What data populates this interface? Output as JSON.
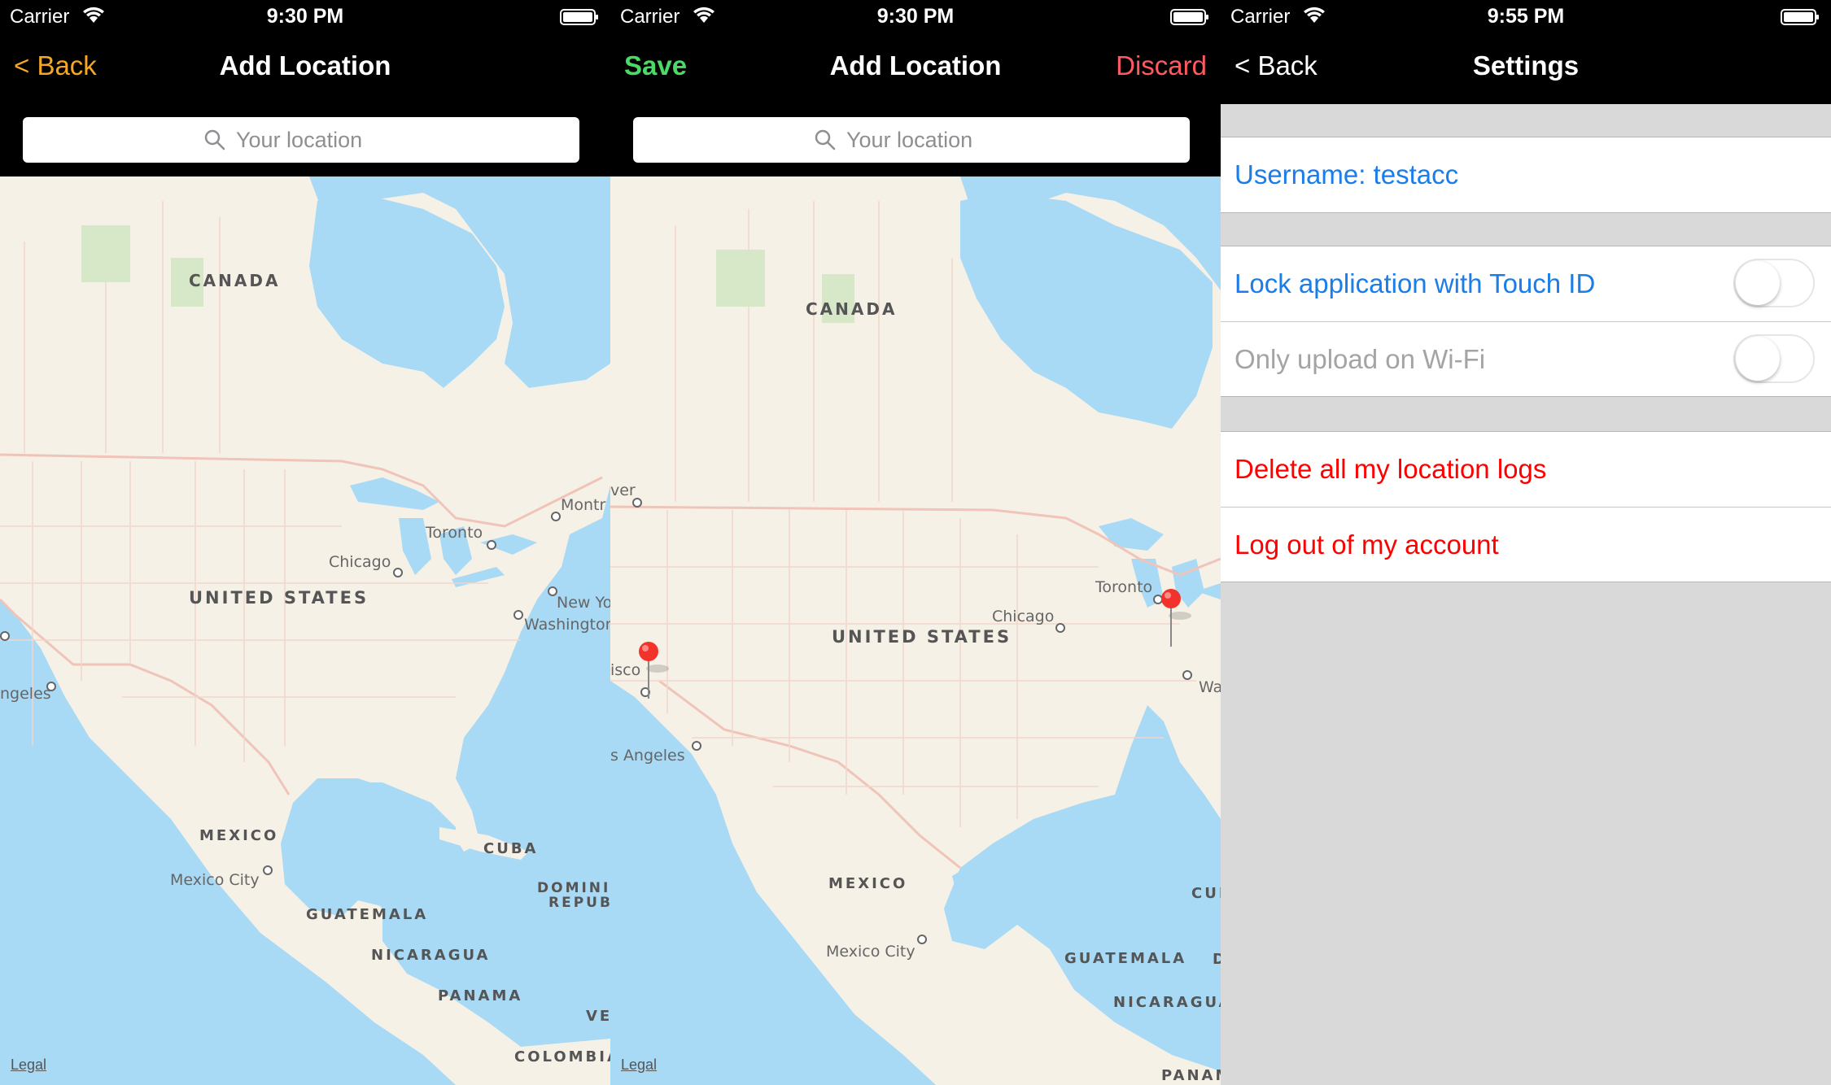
{
  "colors": {
    "accent_orange": "#f5a623",
    "save_green": "#4cd964",
    "discard_red": "#ff5a5f",
    "settings_blue": "#1a7de8",
    "danger_red": "#ff0000",
    "map_water": "#a8d9f5",
    "map_land": "#f6f1e7"
  },
  "screens": [
    {
      "status": {
        "carrier": "Carrier",
        "time": "9:30 PM"
      },
      "nav": {
        "left_label": "< Back",
        "title": "Add Location",
        "right_label": ""
      },
      "search": {
        "placeholder": "Your location"
      },
      "map": {
        "labels": {
          "canada": "CANADA",
          "usa": "UNITED STATES",
          "mexico": "MEXICO",
          "cuba": "CUBA",
          "guatemala": "GUATEMALA",
          "nicaragua": "NICARAGUA",
          "panama": "PANAMA",
          "colombia": "COLOMBIA",
          "dominican1": "DOMINI",
          "dominican2": "REPUB",
          "venezuela": "VE",
          "chicago": "Chicago",
          "toronto": "Toronto",
          "montreal": "Montr",
          "newyork": "New Yo",
          "washington": "Washington",
          "losangeles": "ngeles",
          "mexicocity": "Mexico City"
        },
        "legal": "Legal"
      }
    },
    {
      "status": {
        "carrier": "Carrier",
        "time": "9:30 PM"
      },
      "nav": {
        "left_label": "Save",
        "title": "Add Location",
        "right_label": "Discard"
      },
      "search": {
        "placeholder": "Your location"
      },
      "map": {
        "labels": {
          "canada": "CANADA",
          "usa": "UNITED STATES",
          "mexico": "MEXICO",
          "cuba": "CUBA",
          "guatemala": "GUATEMALA",
          "nicaragua": "NICARAGUA",
          "panama": "PANAMA",
          "chicago": "Chicago",
          "toronto": "Toronto",
          "vancouver": "ver",
          "sanfrancisco": "isco",
          "losangeles": "s Angeles",
          "washington": "Was",
          "mexicocity": "Mexico City",
          "dominican": "D"
        },
        "legal": "Legal",
        "pins": [
          "san-francisco",
          "new-york"
        ]
      }
    },
    {
      "status": {
        "carrier": "Carrier",
        "time": "9:55 PM"
      },
      "nav": {
        "left_label": "< Back",
        "title": "Settings"
      },
      "groups": [
        {
          "rows": [
            {
              "label": "Username: testacc"
            }
          ]
        },
        {
          "rows": [
            {
              "label": "Lock application with Touch ID",
              "toggle": false
            },
            {
              "label": "Only upload on Wi-Fi",
              "toggle": false,
              "disabled": true
            }
          ]
        },
        {
          "rows": [
            {
              "label": "Delete all my location logs"
            },
            {
              "label": "Log out of my account"
            }
          ]
        }
      ]
    }
  ]
}
